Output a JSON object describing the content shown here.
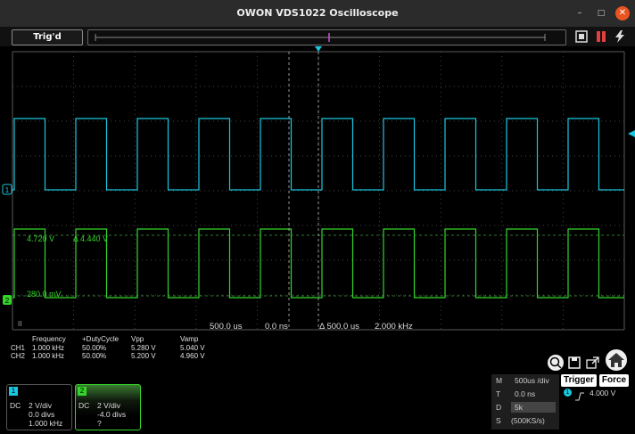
{
  "window": {
    "title": "OWON VDS1022 Oscilloscope",
    "minimize_icon": "–",
    "maximize_icon": "□",
    "close_icon": "✕"
  },
  "toolbar": {
    "trigger_state": "Trig'd"
  },
  "screen": {
    "cursor_labels": {
      "v1": "4.720 V",
      "dv": "Δ 4.440 V",
      "v2": "280.0 mV"
    },
    "bottom_labels": {
      "run": "II",
      "timebase": "500.0 us",
      "offset": "0.0 ns",
      "dt": "Δ 500.0 us",
      "freq": "2.000 kHz"
    },
    "ch1_marker": "1",
    "ch2_marker": "2"
  },
  "measurements": {
    "headers": [
      "Frequency",
      "+DutyCycle",
      "Vpp",
      "Vamp"
    ],
    "rows": [
      {
        "ch": "CH1",
        "values": [
          "1.000 kHz",
          "50.00%",
          "5.280 V",
          "5.040 V"
        ]
      },
      {
        "ch": "CH2",
        "values": [
          "1.000 kHz",
          "50.00%",
          "5.200 V",
          "4.960 V"
        ]
      }
    ]
  },
  "channels": [
    {
      "num": "1",
      "coupling": "DC",
      "scale": "2 V/div",
      "offset": "0.0 divs",
      "freq": "1.000 kHz",
      "color": "#19c8e0"
    },
    {
      "num": "2",
      "coupling": "DC",
      "scale": "2 V/div",
      "offset": "-4.0 divs",
      "freq": "?",
      "color": "#33d52a"
    }
  ],
  "acq": {
    "rows": [
      {
        "k": "M",
        "v": "500us /div"
      },
      {
        "k": "T",
        "v": "0.0 ns"
      },
      {
        "k": "D",
        "v": "5k"
      },
      {
        "k": "S",
        "v": "(500KS/s)"
      }
    ]
  },
  "trigger": {
    "trigger_label": "Trigger",
    "force_label": "Force",
    "source": "1",
    "level": "4.000 V",
    "edge_icon": "rising-edge-icon"
  },
  "colors": {
    "ch1": "#19c8e0",
    "ch2": "#33d52a",
    "grid": "#5a5a5a"
  }
}
